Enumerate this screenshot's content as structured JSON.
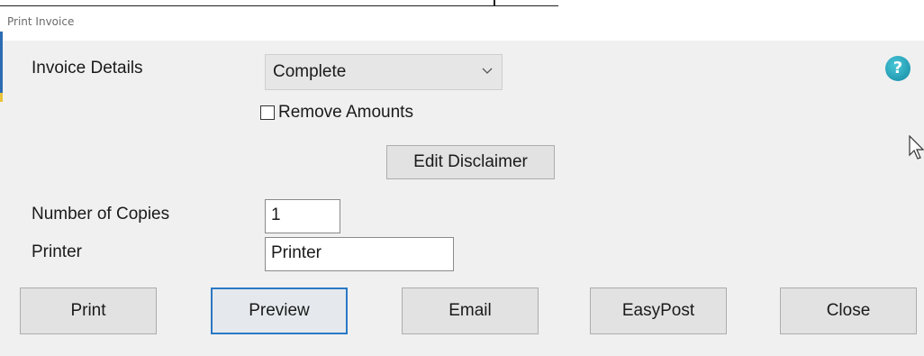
{
  "window": {
    "title": "Print Invoice"
  },
  "form": {
    "invoice_details_label": "Invoice Details",
    "invoice_details_value": "Complete",
    "remove_amounts_label": "Remove Amounts",
    "remove_amounts_checked": false,
    "edit_disclaimer_label": "Edit Disclaimer",
    "copies_label": "Number of Copies",
    "copies_value": "1",
    "printer_label": "Printer",
    "printer_value": "Printer",
    "help_glyph": "?"
  },
  "buttons": {
    "print": "Print",
    "preview": "Preview",
    "email": "Email",
    "easypost": "EasyPost",
    "close": "Close"
  },
  "icons": {
    "select_chevron": "chevron-down-icon",
    "help": "help-icon",
    "cursor": "mouse-pointer-icon"
  },
  "colors": {
    "help_icon": "#1c9fb8",
    "focus_border": "#2b78c5",
    "dialog_bg": "#f0f0f0"
  }
}
